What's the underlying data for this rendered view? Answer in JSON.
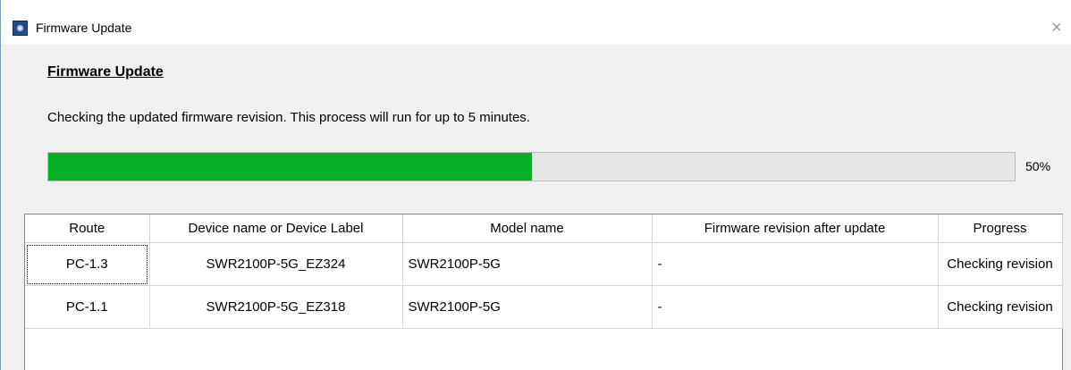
{
  "window": {
    "title": "Firmware Update",
    "close_glyph": "×",
    "icon": "app-icon"
  },
  "content": {
    "heading": "Firmware Update",
    "message": "Checking the updated firmware revision. This process will run for up to 5 minutes."
  },
  "progress": {
    "fraction": 0.5,
    "label": "50%",
    "color": "#06b025"
  },
  "table": {
    "columns": [
      "Route",
      "Device name or Device Label",
      "Model name",
      "Firmware revision after update",
      "Progress"
    ],
    "rows": [
      [
        "PC-1.3",
        "SWR2100P-5G_EZ324",
        "SWR2100P-5G",
        "-",
        "Checking revision"
      ],
      [
        "PC-1.1",
        "SWR2100P-5G_EZ318",
        "SWR2100P-5G",
        "-",
        "Checking revision"
      ]
    ]
  }
}
